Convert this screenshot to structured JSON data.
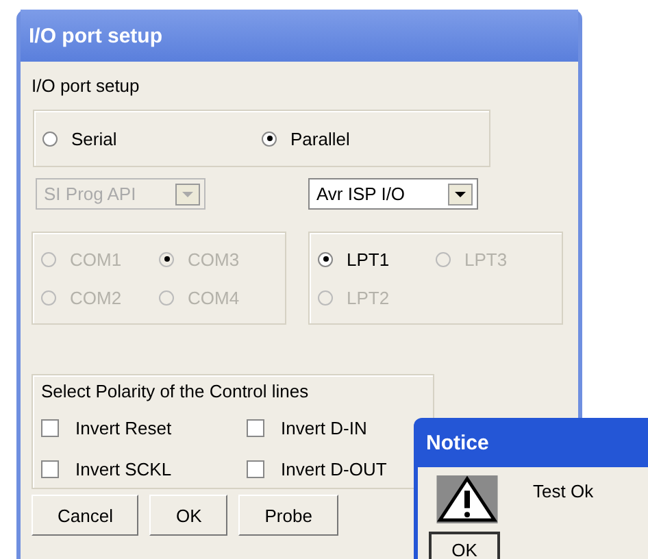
{
  "window": {
    "title": "I/O port setup"
  },
  "heading": "I/O port setup",
  "port_types": [
    {
      "label": "Serial",
      "selected": false
    },
    {
      "label": "Parallel",
      "selected": true
    }
  ],
  "dropdowns": [
    {
      "value": "SI Prog API",
      "disabled": true
    },
    {
      "value": "Avr ISP I/O",
      "disabled": false
    }
  ],
  "com_ports": [
    {
      "label": "COM1",
      "selected": false,
      "disabled": true
    },
    {
      "label": "COM3",
      "selected": true,
      "disabled": true
    },
    {
      "label": "COM2",
      "selected": false,
      "disabled": true
    },
    {
      "label": "COM4",
      "selected": false,
      "disabled": true
    }
  ],
  "lpt_ports": [
    {
      "label": "LPT1",
      "selected": true,
      "disabled": false
    },
    {
      "label": "LPT3",
      "selected": false,
      "disabled": true
    },
    {
      "label": "LPT2",
      "selected": false,
      "disabled": true
    }
  ],
  "polarity": {
    "label": "Select Polarity of the Control lines",
    "options": [
      {
        "label": "Invert Reset",
        "checked": false
      },
      {
        "label": "Invert D-IN",
        "checked": false
      },
      {
        "label": "Invert SCKL",
        "checked": false
      },
      {
        "label": "Invert D-OUT",
        "checked": false
      }
    ]
  },
  "buttons": [
    "Cancel",
    "OK",
    "Probe"
  ],
  "notice": {
    "title": "Notice",
    "message": "Test Ok",
    "button": "OK"
  }
}
